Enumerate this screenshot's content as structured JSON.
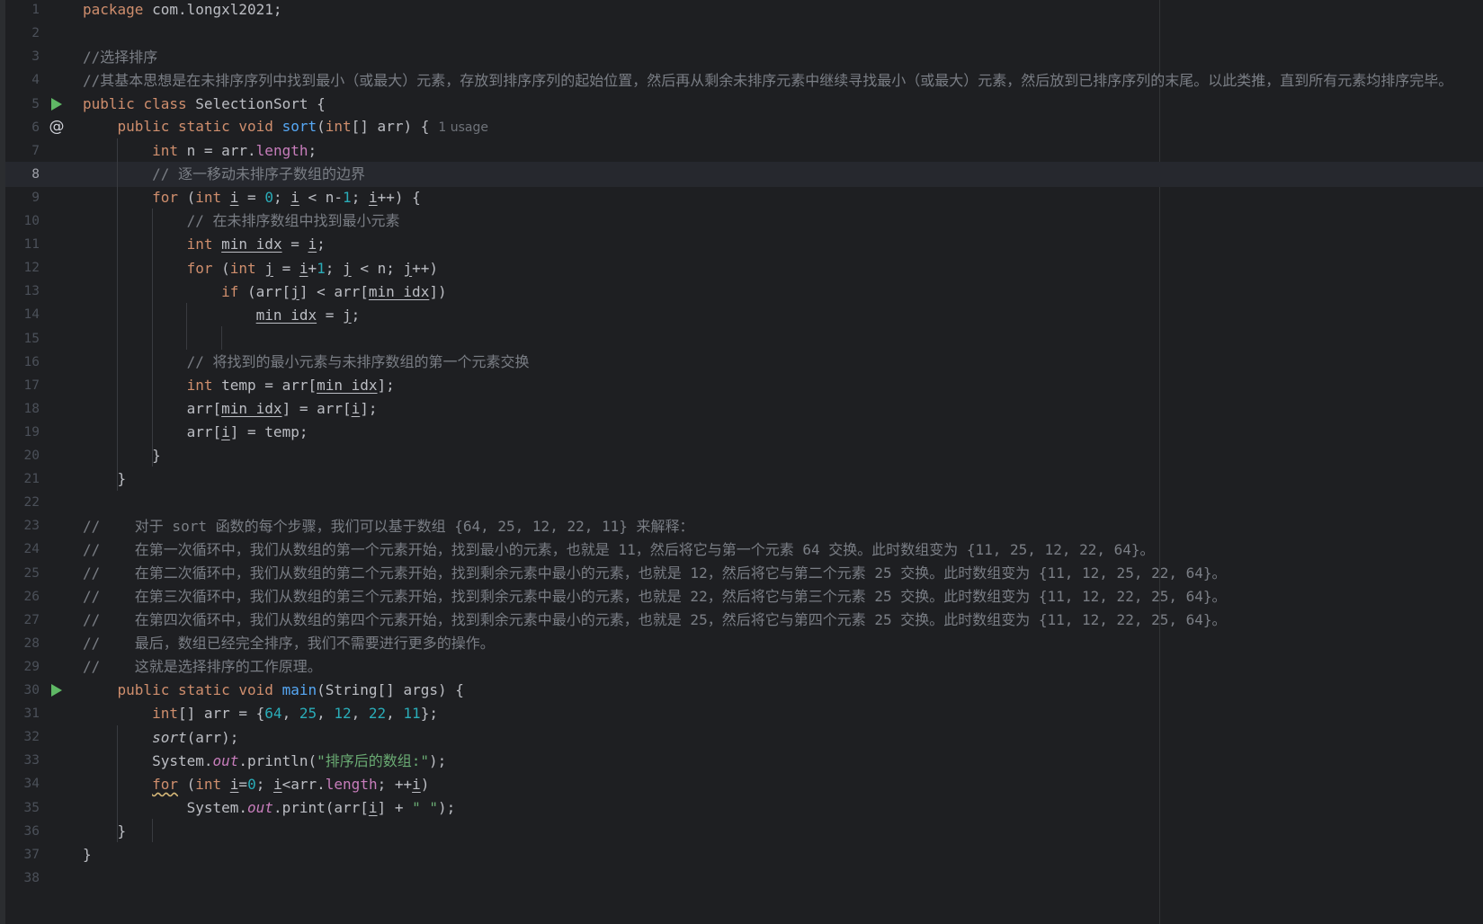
{
  "editor": {
    "file_language": "java",
    "colors": {
      "background": "#1e1f22",
      "keyword": "#cf8e6d",
      "comment": "#7a7e85",
      "number": "#2aacb8",
      "string": "#6aab73",
      "method": "#56a8f5",
      "field": "#c77dbb",
      "text": "#bcbec4"
    },
    "current_line": 8,
    "gutter_icons": [
      {
        "line": 5,
        "icon": "run-icon"
      },
      {
        "line": 6,
        "icon": "override-icon",
        "glyph": "@"
      },
      {
        "line": 30,
        "icon": "run-icon"
      }
    ],
    "inlay_hint": "1 usage",
    "lines": [
      {
        "n": "1",
        "t": "package com.longxl2021;"
      },
      {
        "n": "2",
        "t": ""
      },
      {
        "n": "3",
        "t": "//选择排序"
      },
      {
        "n": "4",
        "t": "//其基本思想是在未排序序列中找到最小（或最大）元素，存放到排序序列的起始位置，然后再从剩余未排序元素中继续寻找最小（或最大）元素，然后放到已排序序列的末尾。以此类推，直到所有元素均排序完毕。"
      },
      {
        "n": "5",
        "t": "public class SelectionSort {"
      },
      {
        "n": "6",
        "t": "    public static void sort(int[] arr) {"
      },
      {
        "n": "7",
        "t": "        int n = arr.length;"
      },
      {
        "n": "8",
        "t": "        // 逐一移动未排序子数组的边界"
      },
      {
        "n": "9",
        "t": "        for (int i = 0; i < n-1; i++) {"
      },
      {
        "n": "10",
        "t": "            // 在未排序数组中找到最小元素"
      },
      {
        "n": "11",
        "t": "            int min_idx = i;"
      },
      {
        "n": "12",
        "t": "            for (int j = i+1; j < n; j++)"
      },
      {
        "n": "13",
        "t": "                if (arr[j] < arr[min_idx])"
      },
      {
        "n": "14",
        "t": "                    min_idx = j;"
      },
      {
        "n": "15",
        "t": ""
      },
      {
        "n": "16",
        "t": "            // 将找到的最小元素与未排序数组的第一个元素交换"
      },
      {
        "n": "17",
        "t": "            int temp = arr[min_idx];"
      },
      {
        "n": "18",
        "t": "            arr[min_idx] = arr[i];"
      },
      {
        "n": "19",
        "t": "            arr[i] = temp;"
      },
      {
        "n": "20",
        "t": "        }"
      },
      {
        "n": "21",
        "t": "    }"
      },
      {
        "n": "22",
        "t": ""
      },
      {
        "n": "23",
        "t": "//    对于 sort 函数的每个步骤，我们可以基于数组 {64, 25, 12, 22, 11} 来解释："
      },
      {
        "n": "24",
        "t": "//    在第一次循环中，我们从数组的第一个元素开始，找到最小的元素，也就是 11，然后将它与第一个元素 64 交换。此时数组变为 {11, 25, 12, 22, 64}。"
      },
      {
        "n": "25",
        "t": "//    在第二次循环中，我们从数组的第二个元素开始，找到剩余元素中最小的元素，也就是 12，然后将它与第二个元素 25 交换。此时数组变为 {11, 12, 25, 22, 64}。"
      },
      {
        "n": "26",
        "t": "//    在第三次循环中，我们从数组的第三个元素开始，找到剩余元素中最小的元素，也就是 22，然后将它与第三个元素 25 交换。此时数组变为 {11, 12, 22, 25, 64}。"
      },
      {
        "n": "27",
        "t": "//    在第四次循环中，我们从数组的第四个元素开始，找到剩余元素中最小的元素，也就是 25，然后将它与第四个元素 25 交换。此时数组变为 {11, 12, 22, 25, 64}。"
      },
      {
        "n": "28",
        "t": "//    最后，数组已经完全排序，我们不需要进行更多的操作。"
      },
      {
        "n": "29",
        "t": "//    这就是选择排序的工作原理。"
      },
      {
        "n": "30",
        "t": "    public static void main(String[] args) {"
      },
      {
        "n": "31",
        "t": "        int[] arr = {64, 25, 12, 22, 11};"
      },
      {
        "n": "32",
        "t": "        sort(arr);"
      },
      {
        "n": "33",
        "t": "        System.out.println(\"排序后的数组:\");"
      },
      {
        "n": "34",
        "t": "        for (int i=0; i<arr.length; ++i)"
      },
      {
        "n": "35",
        "t": "            System.out.print(arr[i] + \" \");"
      },
      {
        "n": "36",
        "t": "    }"
      },
      {
        "n": "37",
        "t": "}"
      },
      {
        "n": "38",
        "t": ""
      }
    ]
  }
}
